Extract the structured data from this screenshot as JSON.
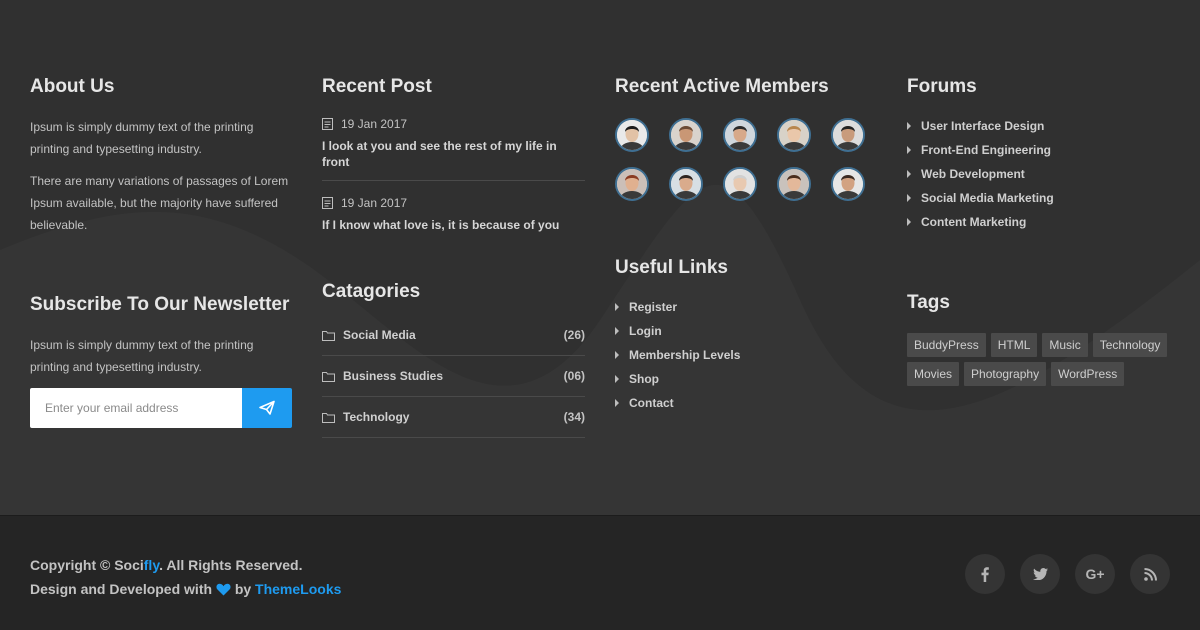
{
  "about": {
    "title": "About Us",
    "para1": "Ipsum is simply dummy text of the printing printing and typesetting industry.",
    "para2": "There are many variations of passages of Lorem Ipsum available, but the majority have suffered believable."
  },
  "newsletter": {
    "title": "Subscribe To Our Newsletter",
    "text": "Ipsum is simply dummy text of the printing printing and typesetting industry.",
    "placeholder": "Enter your email address",
    "send_icon": "paper-plane-icon"
  },
  "recent_post": {
    "title": "Recent Post",
    "posts": [
      {
        "date": "19 Jan 2017",
        "title": "I look at you and see the rest of my life in front"
      },
      {
        "date": "19 Jan 2017",
        "title": "If I know what love is, it is because of you"
      }
    ]
  },
  "categories": {
    "title": "Catagories",
    "items": [
      {
        "name": "Social Media",
        "count": "(26)"
      },
      {
        "name": "Business Studies",
        "count": "(06)"
      },
      {
        "name": "Technology",
        "count": "(34)"
      }
    ]
  },
  "members": {
    "title": "Recent Active Members",
    "count": 10
  },
  "useful_links": {
    "title": "Useful Links",
    "items": [
      "Register",
      "Login",
      "Membership Levels",
      "Shop",
      "Contact"
    ]
  },
  "forums": {
    "title": "Forums",
    "items": [
      "User Interface Design",
      "Front-End Engineering",
      "Web Development",
      "Social Media Marketing",
      "Content Marketing"
    ]
  },
  "tags": {
    "title": "Tags",
    "items": [
      "BuddyPress",
      "HTML",
      "Music",
      "Technology",
      "Movies",
      "Photography",
      "WordPress"
    ]
  },
  "bottom": {
    "copyright_prefix": "Copyright © Soci",
    "copyright_brand": "fly",
    "copyright_suffix": ". All Rights Reserved.",
    "design_prefix": "Design and Developed with",
    "design_by": "by",
    "design_brand": "ThemeLooks",
    "social": [
      {
        "icon": "facebook-icon",
        "glyph": "f"
      },
      {
        "icon": "twitter-icon",
        "glyph": "t"
      },
      {
        "icon": "google-plus-icon",
        "glyph": "G+"
      },
      {
        "icon": "rss-icon",
        "glyph": "rss"
      }
    ]
  },
  "colors": {
    "accent": "#1e9bf0",
    "background": "#303030",
    "bottom_bar": "#252525"
  }
}
